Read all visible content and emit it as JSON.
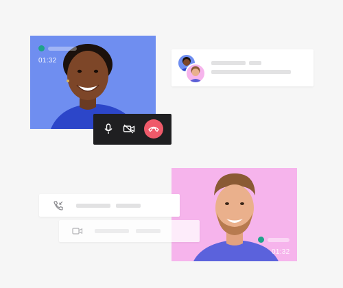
{
  "caller_video": {
    "timer": "01:32",
    "status_dot_color": "#1fa38a",
    "background_color": "#6f8ef0"
  },
  "callee_video": {
    "timer": "01:32",
    "status_dot_color": "#1fa38a",
    "background_color": "#f6b4ec"
  },
  "call_controls": {
    "mic_icon": "microphone-icon",
    "camera_icon": "video-off-icon",
    "hangup_icon": "phone-hangup-icon",
    "hangup_color": "#ef5a6a"
  },
  "contact_card": {
    "avatars": [
      "woman-avatar",
      "man-avatar"
    ]
  },
  "call_log": {
    "items": [
      {
        "icon": "phone-incoming-icon"
      },
      {
        "icon": "video-camera-icon"
      }
    ]
  }
}
